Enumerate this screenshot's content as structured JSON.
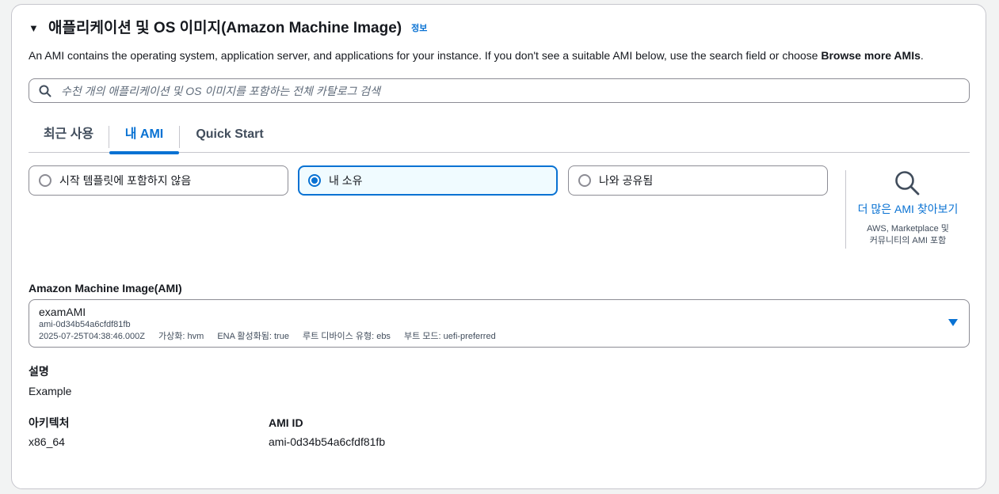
{
  "section": {
    "title": "애플리케이션 및 OS 이미지(Amazon Machine Image)",
    "info_link": "정보",
    "description_prefix": "An AMI contains the operating system, application server, and applications for your instance. If you don't see a suitable AMI below, use the search field or choose ",
    "description_bold": "Browse more AMIs",
    "description_suffix": "."
  },
  "search": {
    "placeholder": "수천 개의 애플리케이션 및 OS 이미지를 포함하는 전체 카탈로그 검색",
    "icon": "search-icon"
  },
  "tabs": [
    {
      "label": "최근 사용",
      "active": false
    },
    {
      "label": "내 AMI",
      "active": true
    },
    {
      "label": "Quick Start",
      "active": false
    }
  ],
  "ownership_options": [
    {
      "label": "시작 템플릿에 포함하지 않음",
      "selected": false
    },
    {
      "label": "내 소유",
      "selected": true
    },
    {
      "label": "나와 공유됨",
      "selected": false
    }
  ],
  "browse_more": {
    "icon": "magnifier-icon",
    "link": "더 많은 AMI 찾아보기",
    "sub_line1": "AWS, Marketplace 및",
    "sub_line2": "커뮤니티의 AMI 포함"
  },
  "ami_field": {
    "label": "Amazon Machine Image(AMI)",
    "name": "examAMI",
    "id": "ami-0d34b54a6cfdf81fb",
    "created": "2025-07-25T04:38:46.000Z",
    "virtualization": "가상화: hvm",
    "ena": "ENA 활성화됨: true",
    "root_device": "루트 디바이스 유형: ebs",
    "boot_mode": "부트 모드: uefi-preferred"
  },
  "details": {
    "description_label": "설명",
    "description_value": "Example",
    "architecture_label": "아키텍처",
    "architecture_value": "x86_64",
    "ami_id_label": "AMI ID",
    "ami_id_value": "ami-0d34b54a6cfdf81fb"
  },
  "colors": {
    "accent": "#0972d3",
    "text": "#16191f",
    "border": "#8c8c94",
    "selected_bg": "#f0fbff"
  }
}
